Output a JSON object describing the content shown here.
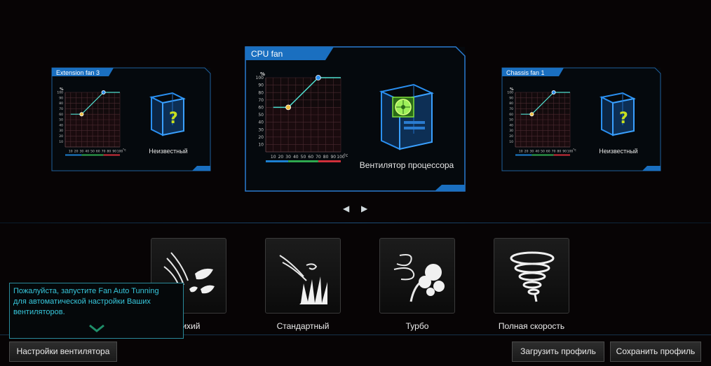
{
  "fans": [
    {
      "title": "Extension fan 3",
      "status": "Неизвестный"
    },
    {
      "title": "CPU fan",
      "status": "Вентилятор процессора"
    },
    {
      "title": "Chassis fan 1",
      "status": "Неизвестный"
    }
  ],
  "graph": {
    "y_unit": "%",
    "x_unit": "°c",
    "y_ticks": [
      "100",
      "90",
      "80",
      "70",
      "60",
      "50",
      "40",
      "30",
      "20",
      "10"
    ],
    "x_ticks": [
      "10",
      "20",
      "30",
      "40",
      "50",
      "60",
      "70",
      "80",
      "90",
      "100"
    ],
    "curve_points": [
      [
        10,
        60
      ],
      [
        30,
        60
      ],
      [
        70,
        100
      ],
      [
        100,
        100
      ]
    ],
    "handles": [
      [
        30,
        60
      ],
      [
        70,
        100
      ]
    ]
  },
  "navigation": {
    "prev": "◀",
    "next": "▶"
  },
  "modes": [
    {
      "label": "Тихий",
      "icon": "quiet-icon"
    },
    {
      "label": "Стандартный",
      "icon": "standard-icon"
    },
    {
      "label": "Турбо",
      "icon": "turbo-icon"
    },
    {
      "label": "Полная скорость",
      "icon": "full-speed-icon"
    }
  ],
  "tooltip": {
    "lines": [
      "Пожалуйста, запустите Fan Auto Tunning",
      "для автоматической настройки Ваших",
      "вентиляторов."
    ]
  },
  "buttons": {
    "fan_settings": "Настройки вентилятора",
    "load_profile": "Загрузить профиль",
    "save_profile": "Сохранить профиль"
  },
  "colors": {
    "accent": "#1e6fb8",
    "curve": "#4fe0d0",
    "grid_top": "#3d2a2a",
    "bar_blue": "#1d7fd0",
    "bar_green": "#2fa84f",
    "bar_red": "#d0303a"
  }
}
